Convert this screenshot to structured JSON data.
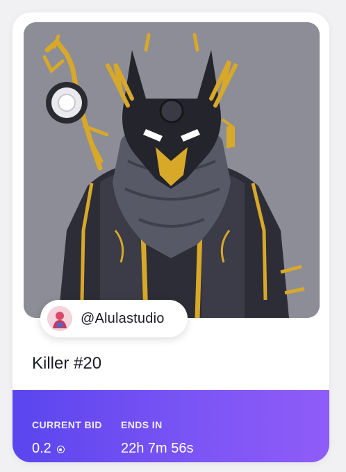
{
  "card": {
    "creator": "@Alulastudio",
    "title": "Killer #20",
    "current_bid_label": "CURRENT BID",
    "current_bid_value": "0.2",
    "ends_in_label": "ENDS IN",
    "ends_in_value": "22h 7m 56s"
  },
  "icons": {
    "currency": "coin-icon"
  },
  "colors": {
    "gradient_start": "#5a45ee",
    "gradient_end": "#8f5cf8",
    "artwork_background": "#8d8d97"
  }
}
